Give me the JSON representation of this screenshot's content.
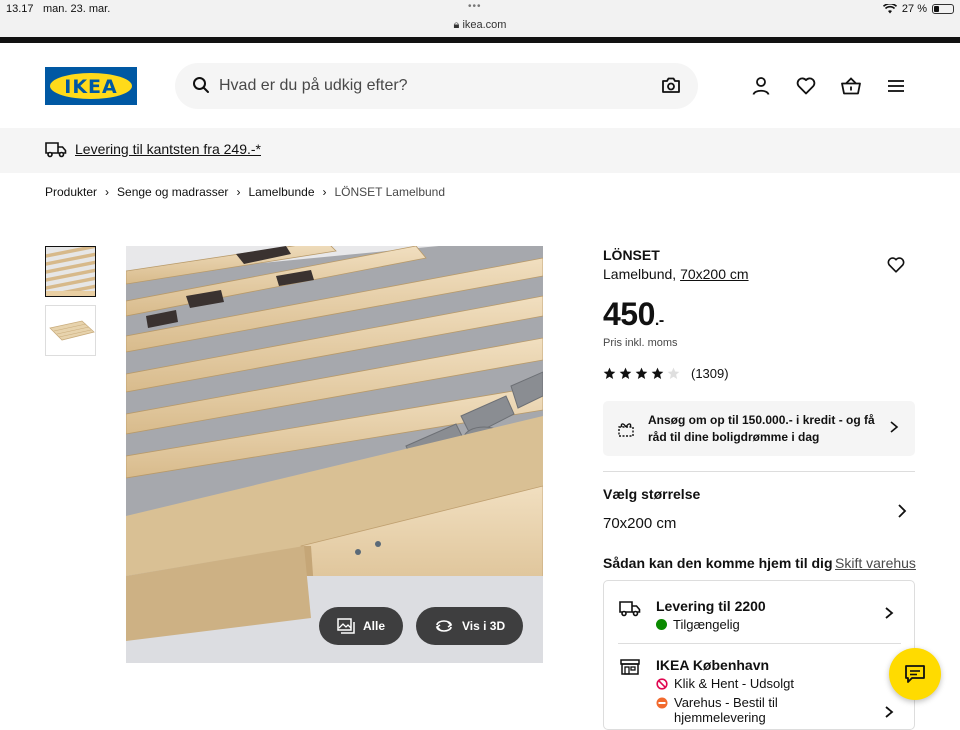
{
  "status_bar": {
    "time": "13.17",
    "date": "man. 23. mar.",
    "url": "ikea.com",
    "battery": "27 %"
  },
  "header": {
    "logo_text": "IKEA",
    "search_placeholder": "Hvad er du på udkig efter?",
    "icons": [
      "search-icon",
      "camera-icon",
      "profile-icon",
      "heart-icon",
      "cart-icon",
      "menu-icon"
    ]
  },
  "banner": {
    "delivery_text": "Levering til kantsten fra 249.-*"
  },
  "breadcrumb": {
    "items": [
      "Produkter",
      "Senge og madrasser",
      "Lamelbunde"
    ],
    "current": "LÖNSET Lamelbund"
  },
  "gallery": {
    "all_label": "Alle",
    "view3d_label": "Vis i 3D"
  },
  "product": {
    "name": "LÖNSET",
    "type": "Lamelbund,",
    "size_link": "70x200 cm",
    "price_main": "450",
    "price_suffix": ".-",
    "price_note": "Pris inkl. moms",
    "rating": 4,
    "rating_max": 5,
    "review_count": "(1309)"
  },
  "credit_banner": {
    "text": "Ansøg om op til 150.000.- i kredit - og få råd til dine boligdrømme i dag"
  },
  "size_selector": {
    "label": "Vælg størrelse",
    "value": "70x200 cm"
  },
  "fulfillment": {
    "heading": "Sådan kan den komme hjem til dig",
    "change_store": "Skift varehus",
    "delivery": {
      "title": "Levering til 2200",
      "status": "Tilgængelig",
      "status_color": "#0a8a00"
    },
    "store": {
      "title": "IKEA København",
      "click_collect": "Klik & Hent - Udsolgt",
      "click_collect_color": "#e00751",
      "warehouse": "Varehus - Bestil til hjemmelevering",
      "warehouse_color": "#f26a2e"
    }
  },
  "colors": {
    "brand_blue": "#0058a3",
    "brand_yellow": "#ffda1a",
    "chat_yellow": "#ffdb00"
  }
}
